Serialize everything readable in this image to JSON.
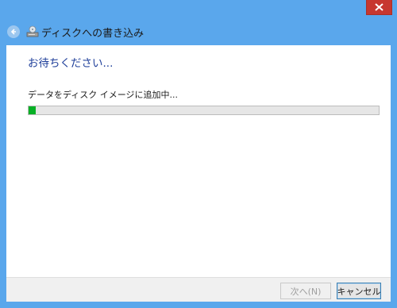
{
  "window": {
    "title": "ディスクへの書き込み",
    "close_label": "×"
  },
  "main": {
    "heading": "お待ちください...",
    "status": "データをディスク イメージに追加中...",
    "progress_percent": 2
  },
  "footer": {
    "next_label": "次へ(N)",
    "cancel_label": "キャンセル"
  },
  "colors": {
    "frame": "#5aa7ec",
    "accent_heading": "#1f3f9a",
    "progress_fill": "#06b025",
    "close_button": "#c7372f"
  },
  "icons": {
    "back": "back-arrow-icon",
    "disc": "disc-burn-icon",
    "close": "close-icon"
  }
}
